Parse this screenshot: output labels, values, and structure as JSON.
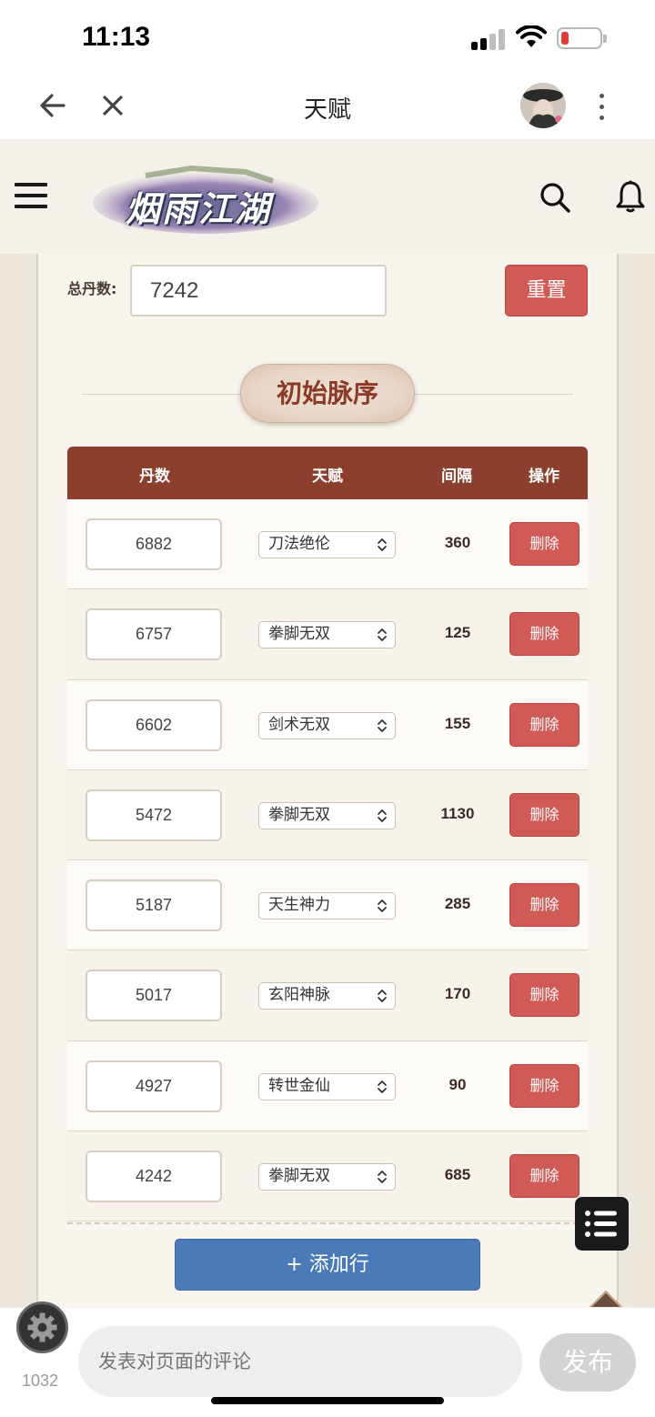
{
  "status_bar": {
    "time": "11:13"
  },
  "nav": {
    "title": "天赋"
  },
  "site": {
    "logo_text": "烟雨江湖"
  },
  "form": {
    "total_label": "总丹数:",
    "total_value": "7242",
    "reset_label": "重置"
  },
  "section": {
    "title": "初始脉序"
  },
  "table": {
    "headers": {
      "dan": "丹数",
      "talent": "天赋",
      "interval": "间隔",
      "action": "操作"
    },
    "rows": [
      {
        "dan": "6882",
        "talent": "刀法绝伦",
        "interval": "360",
        "action": "删除"
      },
      {
        "dan": "6757",
        "talent": "拳脚无双",
        "interval": "125",
        "action": "删除"
      },
      {
        "dan": "6602",
        "talent": "剑术无双",
        "interval": "155",
        "action": "删除"
      },
      {
        "dan": "5472",
        "talent": "拳脚无双",
        "interval": "1130",
        "action": "删除"
      },
      {
        "dan": "5187",
        "talent": "天生神力",
        "interval": "285",
        "action": "删除"
      },
      {
        "dan": "5017",
        "talent": "玄阳神脉",
        "interval": "170",
        "action": "删除"
      },
      {
        "dan": "4927",
        "talent": "转世金仙",
        "interval": "90",
        "action": "删除"
      },
      {
        "dan": "4242",
        "talent": "拳脚无双",
        "interval": "685",
        "action": "删除"
      }
    ],
    "add_row_label": "+ 添加行"
  },
  "comment_bar": {
    "count": "1032",
    "placeholder": "发表对页面的评论",
    "publish_label": "发布"
  },
  "colors": {
    "header_brown": "#8b3f2c",
    "delete_red": "#d05a55",
    "add_blue": "#4a7ab8"
  },
  "icons": [
    "back-arrow-icon",
    "close-icon",
    "more-icon",
    "menu-icon",
    "search-icon",
    "bell-icon",
    "chevron-updown-icon",
    "list-icon",
    "chevron-up-icon",
    "gear-icon"
  ]
}
